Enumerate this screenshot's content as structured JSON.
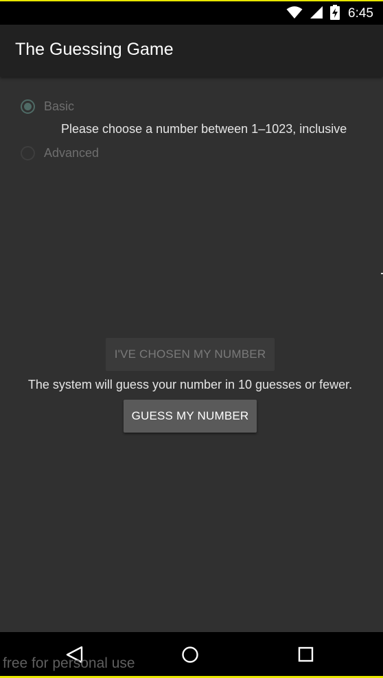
{
  "status_bar": {
    "time": "6:45",
    "icons": [
      "wifi-icon",
      "signal-icon",
      "battery-charging-icon"
    ]
  },
  "app_bar": {
    "title": "The Guessing Game"
  },
  "mode_options": [
    {
      "label": "Basic",
      "checked": true
    },
    {
      "label": "Advanced",
      "checked": false
    }
  ],
  "hint": "Please choose a number between 1–1023, inclusive",
  "chosen_button_label": "I'VE CHOSEN MY NUMBER",
  "info": "The system will guess your number in 10 guesses or fewer.",
  "guess_button_label": "GUESS MY NUMBER",
  "nav_bar": {
    "icons": [
      "back-icon",
      "home-icon",
      "recents-icon"
    ]
  },
  "watermark": "free for personal use",
  "colors": {
    "background": "#303030",
    "app_bar": "#212121",
    "accent_disabled": "#4f6b66",
    "status_border": "#e8e600"
  }
}
